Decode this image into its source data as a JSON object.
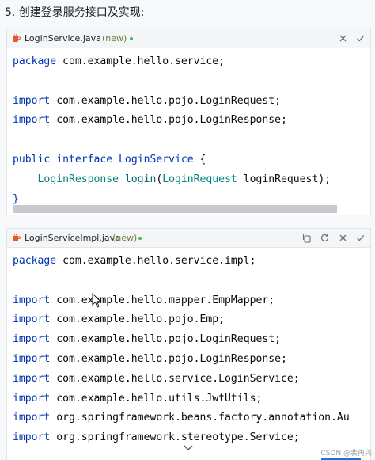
{
  "step_title": "5. 创建登录服务接口及实现:",
  "watermark": "CSDN @裴再兴",
  "colors": {
    "keyword": "#0033b3",
    "type": "#008080",
    "method": "#00627a",
    "new_tag": "#6f7a3c",
    "new_dot": "#4caf6a"
  },
  "cards": [
    {
      "file_name": "LoginService.java",
      "new_tag": "(new)",
      "icons": [
        "java-file-icon",
        "close-icon",
        "check-icon"
      ],
      "code": [
        [
          [
            "kw",
            "package"
          ],
          [
            "txt",
            " com.example.hello.service;"
          ]
        ],
        [],
        [
          [
            "kw",
            "import"
          ],
          [
            "txt",
            " com.example.hello.pojo.LoginRequest;"
          ]
        ],
        [
          [
            "kw",
            "import"
          ],
          [
            "txt",
            " com.example.hello.pojo.LoginResponse;"
          ]
        ],
        [],
        [
          [
            "kw",
            "public"
          ],
          [
            "txt",
            " "
          ],
          [
            "kw",
            "interface"
          ],
          [
            "txt",
            " "
          ],
          [
            "iface",
            "LoginService"
          ],
          [
            "txt",
            " {"
          ]
        ],
        [
          [
            "txt",
            "    "
          ],
          [
            "type",
            "LoginResponse"
          ],
          [
            "txt",
            " "
          ],
          [
            "method",
            "login"
          ],
          [
            "txt",
            "("
          ],
          [
            "type",
            "LoginRequest"
          ],
          [
            "txt",
            " loginRequest);"
          ]
        ],
        [
          [
            "kw",
            "}"
          ]
        ]
      ]
    },
    {
      "file_name": "LoginServiceImpl.java",
      "new_tag": "(new)",
      "icons": [
        "java-file-icon",
        "copy-icon",
        "refresh-icon",
        "close-icon",
        "check-icon"
      ],
      "code": [
        [
          [
            "kw",
            "package"
          ],
          [
            "txt",
            " com.example.hello.service.impl;"
          ]
        ],
        [],
        [
          [
            "kw",
            "import"
          ],
          [
            "txt",
            " com.example.hello.mapper.EmpMapper;"
          ]
        ],
        [
          [
            "kw",
            "import"
          ],
          [
            "txt",
            " com.example.hello.pojo.Emp;"
          ]
        ],
        [
          [
            "kw",
            "import"
          ],
          [
            "txt",
            " com.example.hello.pojo.LoginRequest;"
          ]
        ],
        [
          [
            "kw",
            "import"
          ],
          [
            "txt",
            " com.example.hello.pojo.LoginResponse;"
          ]
        ],
        [
          [
            "kw",
            "import"
          ],
          [
            "txt",
            " com.example.hello.service.LoginService;"
          ]
        ],
        [
          [
            "kw",
            "import"
          ],
          [
            "txt",
            " com.example.hello.utils.JwtUtils;"
          ]
        ],
        [
          [
            "kw",
            "import"
          ],
          [
            "txt",
            " org.springframework.beans.factory.annotation.Au"
          ]
        ],
        [
          [
            "kw",
            "import"
          ],
          [
            "txt",
            " org.springframework.stereotype.Service;"
          ]
        ]
      ]
    }
  ]
}
